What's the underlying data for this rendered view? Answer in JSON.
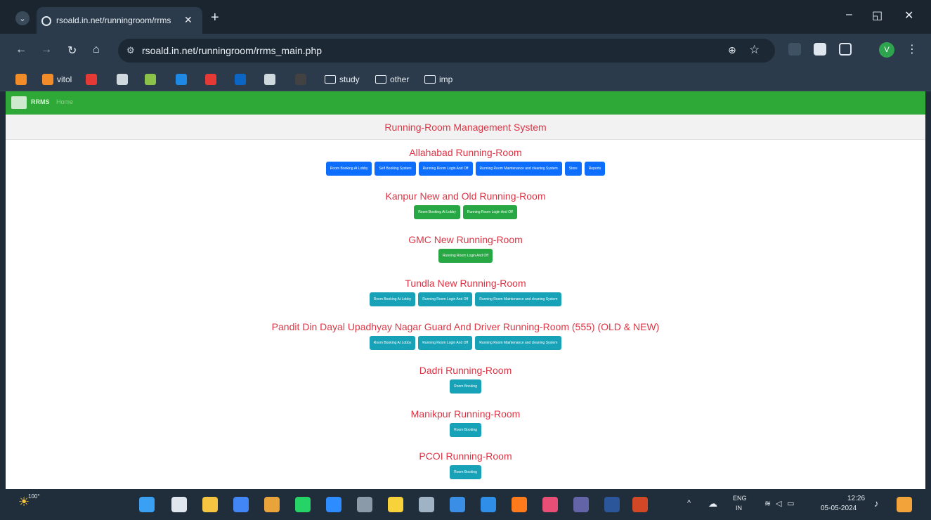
{
  "browser": {
    "tab_title": "rsoald.in.net/runningroom/rrms",
    "url": "rsoald.in.net/runningroom/rrms_main.php",
    "profile_initial": "V",
    "bookmarks": [
      {
        "label": "",
        "color": "#f28c28"
      },
      {
        "label": "vitol",
        "color": "#f28c28"
      },
      {
        "label": "",
        "color": "#e53935"
      },
      {
        "label": "",
        "color": "#cfd8dc"
      },
      {
        "label": "",
        "color": "#8bc34a"
      },
      {
        "label": "",
        "color": "#1e88e5"
      },
      {
        "label": "",
        "color": "#e53935"
      },
      {
        "label": "",
        "color": "#0a66c2"
      },
      {
        "label": "",
        "color": "#cfd8dc"
      },
      {
        "label": "",
        "color": "#424242"
      }
    ],
    "bookmark_folders": [
      "study",
      "other",
      "imp"
    ]
  },
  "page": {
    "brand": "RRMS",
    "home": "Home",
    "system_title": "Running-Room Management System",
    "sections": [
      {
        "title": "Allahabad Running-Room",
        "color": "blue",
        "buttons": [
          "Room Booking At Lobby",
          "Self Booking System",
          "Running Room Login And Off",
          "Running Room Maintenance and cleaning System",
          "Store",
          "Reports"
        ]
      },
      {
        "title": "Kanpur New and Old Running-Room",
        "color": "green",
        "buttons": [
          "Room Booking At Lobby",
          "Running Room Login And Off"
        ]
      },
      {
        "title": "GMC New Running-Room",
        "color": "green",
        "buttons": [
          "Running Room Login And Off"
        ]
      },
      {
        "title": "Tundla New Running-Room",
        "color": "teal",
        "buttons": [
          "Room Booking At Lobby",
          "Running Room Login And Off",
          "Running Room Maintenance and cleaning System"
        ]
      },
      {
        "title": "Pandit Din Dayal Upadhyay Nagar Guard And Driver Running-Room (555) (OLD & NEW)",
        "color": "teal",
        "buttons": [
          "Room Booking At Lobby",
          "Running Room Login And Off",
          "Running Room Maintenance and cleaning System"
        ]
      },
      {
        "title": "Dadri Running-Room",
        "color": "teal",
        "buttons": [
          "Room Booking"
        ]
      },
      {
        "title": "Manikpur Running-Room",
        "color": "teal",
        "buttons": [
          "Room Booking"
        ]
      },
      {
        "title": "PCOI Running-Room",
        "color": "teal",
        "buttons": [
          "Room Booking"
        ]
      }
    ]
  },
  "taskbar": {
    "weather": "100°",
    "lang_top": "ENG",
    "lang_bottom": "IN",
    "time": "12:26",
    "date": "05-05-2024"
  }
}
